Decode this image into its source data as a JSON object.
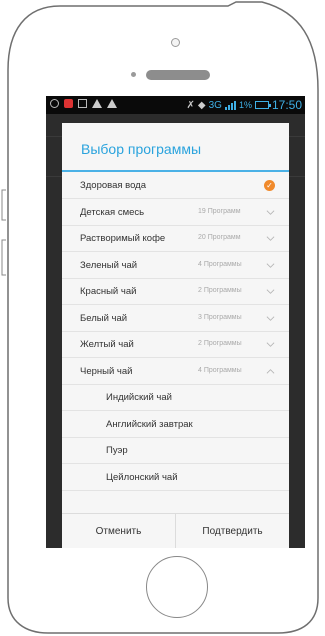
{
  "status_bar": {
    "network": "3G",
    "battery_percent": "1%",
    "time": "17:50",
    "icons": [
      "sync-icon",
      "app-notification-icon",
      "image-icon",
      "warning-icon",
      "warning-icon",
      "mute-icon",
      "wifi-icon",
      "signal-icon",
      "battery-icon"
    ]
  },
  "dialog": {
    "title": "Выбор программы",
    "items": [
      {
        "label": "Здоровая вода",
        "count": "",
        "state": "selected"
      },
      {
        "label": "Детская смесь",
        "count": "19 Программ",
        "state": "collapsed"
      },
      {
        "label": "Растворимый кофе",
        "count": "20 Программ",
        "state": "collapsed"
      },
      {
        "label": "Зеленый чай",
        "count": "4 Программы",
        "state": "collapsed"
      },
      {
        "label": "Красный чай",
        "count": "2 Программы",
        "state": "collapsed"
      },
      {
        "label": "Белый чай",
        "count": "3 Программы",
        "state": "collapsed"
      },
      {
        "label": "Желтый чай",
        "count": "2 Программы",
        "state": "collapsed"
      },
      {
        "label": "Черный чай",
        "count": "4 Программы",
        "state": "expanded"
      }
    ],
    "subitems": [
      "Индийский чай",
      "Английский завтрак",
      "Пуэр",
      "Цейлонский чай"
    ],
    "cancel_label": "Отменить",
    "confirm_label": "Подтвердить"
  },
  "colors": {
    "accent": "#2aa3dd",
    "check": "#f08a2c",
    "status_text": "#3fb0e6"
  }
}
